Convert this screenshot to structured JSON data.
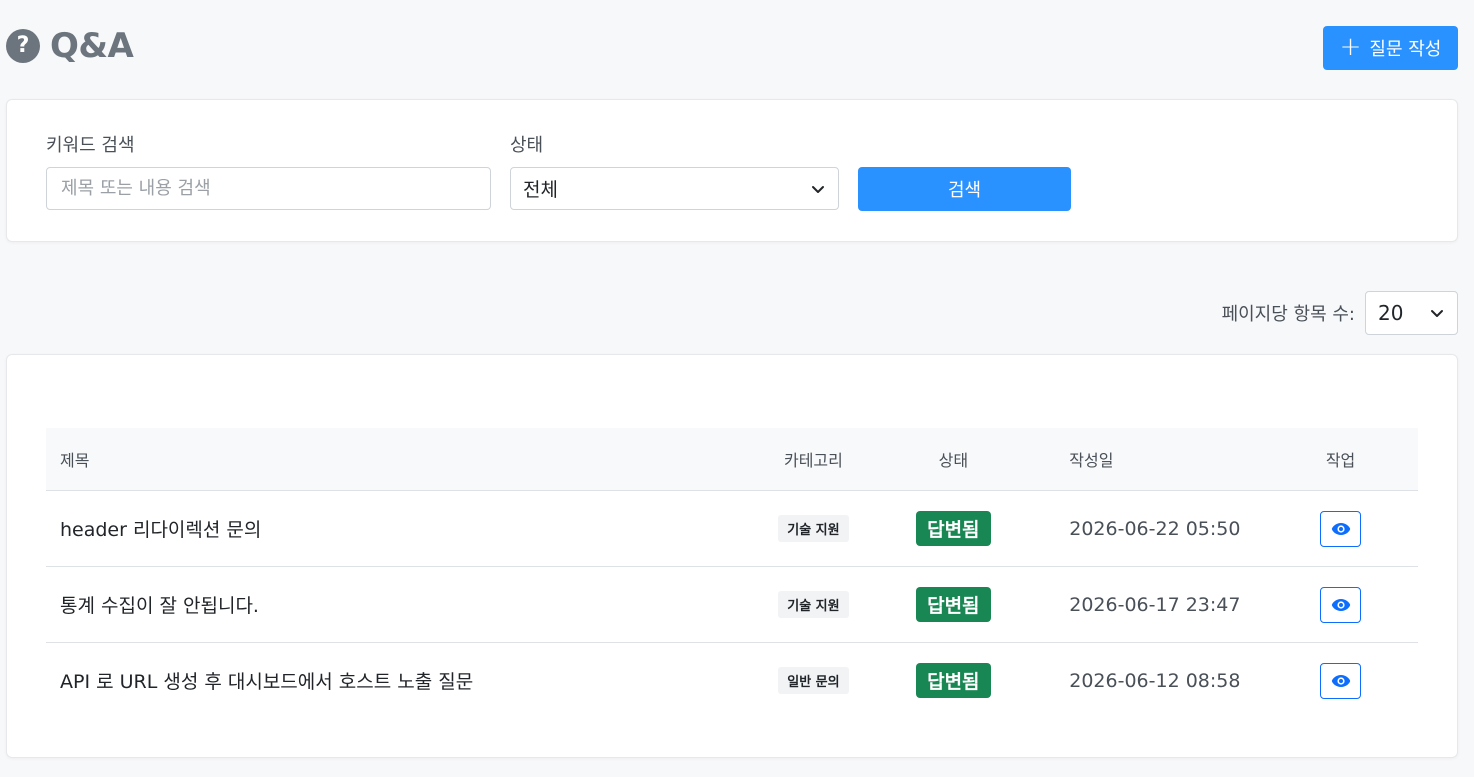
{
  "header": {
    "help_icon_glyph": "?",
    "title": "Q&A",
    "write_button_icon": "+",
    "write_button_label": "질문 작성"
  },
  "search": {
    "keyword_label": "키워드 검색",
    "keyword_placeholder": "제목 또는 내용 검색",
    "keyword_value": "",
    "status_label": "상태",
    "status_selected": "전체",
    "search_button_label": "검색"
  },
  "pagination": {
    "per_page_label": "페이지당 항목 수:",
    "per_page_selected": "20"
  },
  "table": {
    "columns": {
      "title": "제목",
      "category": "카테고리",
      "status": "상태",
      "date": "작성일",
      "action": "작업"
    },
    "rows": [
      {
        "title": "header 리다이렉션 문의",
        "category": "기술 지원",
        "status": "답변됨",
        "date": "2026-06-22 05:50"
      },
      {
        "title": "통계 수집이 잘 안됩니다.",
        "category": "기술 지원",
        "status": "답변됨",
        "date": "2026-06-17 23:47"
      },
      {
        "title": "API 로 URL 생성 후 대시보드에서 호스트 노출 질문",
        "category": "일반 문의",
        "status": "답변됨",
        "date": "2026-06-12 08:58"
      }
    ]
  },
  "colors": {
    "primary": "#2a92ff",
    "status_answered": "#198754",
    "view_button_border": "#0d6efd"
  },
  "icons": {
    "help": "question-circle-icon",
    "add": "plus-icon",
    "dropdown": "chevron-down-icon",
    "view": "eye-icon"
  }
}
